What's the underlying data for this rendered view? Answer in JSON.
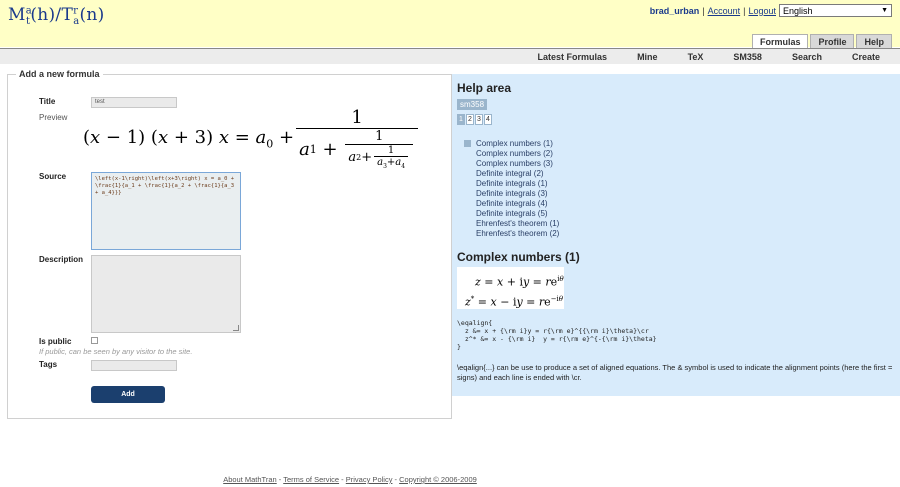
{
  "header": {
    "logo_base": "M",
    "logo_sup": "a",
    "logo_sub": "t",
    "logo_h": "(h)/T",
    "logo_sup2": "r",
    "logo_sub2": "a",
    "logo_tail": "(n)",
    "user": "brad_urban",
    "account_link": "Account",
    "logout_link": "Logout",
    "language": "English",
    "tabs": [
      {
        "label": "Formulas",
        "active": true
      },
      {
        "label": "Profile",
        "active": false
      },
      {
        "label": "Help",
        "active": false
      }
    ],
    "subnav": [
      "Latest Formulas",
      "Mine",
      "TeX",
      "SM358",
      "Search",
      "Create"
    ]
  },
  "form": {
    "legend": "Add a new formula",
    "title_label": "Title",
    "title_value": "test",
    "preview_label": "Preview",
    "source_label": "Source",
    "source_value": "\\left(x-1\\right)\\left(x+3\\right) x = a_0 + \\frac{1}{a_1 + \\frac{1}{a_2 + \\frac{1}{a_3 + a_4}}}",
    "description_label": "Description",
    "description_value": "",
    "public_label": "Is public",
    "public_hint": "If public, can be seen by any visitor to the site.",
    "tags_label": "Tags",
    "tags_value": "",
    "add_button": "Add"
  },
  "help": {
    "title": "Help area",
    "tag": "sm358",
    "pages": [
      "1",
      "2",
      "3",
      "4"
    ],
    "active_page": "1",
    "items": [
      "Complex numbers (1)",
      "Complex numbers (2)",
      "Complex numbers (3)",
      "Definite integral (2)",
      "Definite integrals (1)",
      "Definite integrals (3)",
      "Definite integrals (4)",
      "Definite integrals (5)",
      "Ehrenfest's theorem (1)",
      "Ehrenfest's theorem (2)"
    ],
    "subtitle": "Complex numbers (1)",
    "code": "\\eqalign{\n  z &= x + {\\rm i}y = r{\\rm e}^{{\\rm i}\\theta}\\cr\n  z^* &= x - {\\rm i}  y = r{\\rm e}^{-{\\rm i}\\theta}\n}",
    "description": "\\eqalign{...} can be use to produce a set of aligned equations. The & symbol is used to indicate the alignment points (here the first = signs) and each line is ended with \\cr."
  },
  "footer": {
    "about": "About MathTran",
    "terms": "Terms of Service",
    "privacy": "Privacy Policy",
    "copyright": "Copyright © 2006-2009"
  }
}
